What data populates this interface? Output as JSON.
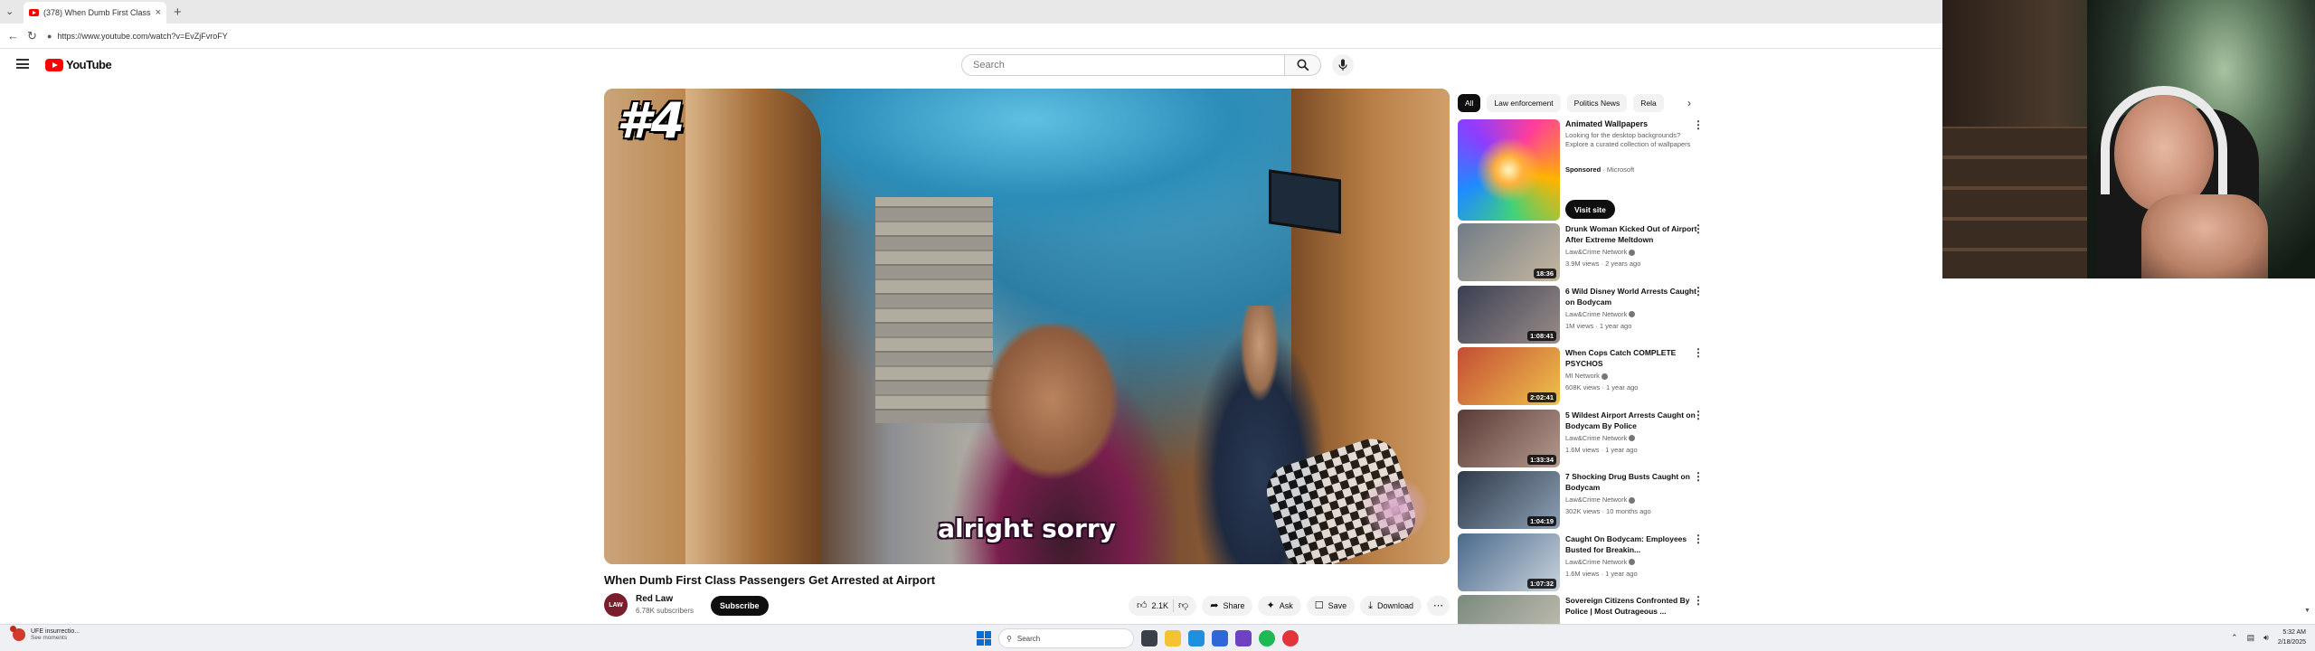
{
  "browser": {
    "tab_title": "(378) When Dumb First Class",
    "url": "https://www.youtube.com/watch?v=EvZjFvroFY"
  },
  "youtube": {
    "logo_text": "YouTube",
    "search_placeholder": "Search"
  },
  "player": {
    "overlay_rank": "#4",
    "caption": "alright sorry"
  },
  "video": {
    "title": "When Dumb First Class Passengers Get Arrested at Airport",
    "channel_name": "Red Law",
    "channel_avatar_text": "LAW",
    "subscribers": "6.78K subscribers",
    "subscribe_label": "Subscribe",
    "like_count": "2.1K",
    "share_label": "Share",
    "ask_label": "Ask",
    "save_label": "Save",
    "download_label": "Download"
  },
  "chips": [
    "All",
    "Law enforcement",
    "Politics News",
    "Rela"
  ],
  "ad": {
    "title": "Animated Wallpapers",
    "description": "Looking for the desktop backgrounds? Explore a curated collection of wallpapers",
    "sponsored_label": "Sponsored",
    "sponsor": "Microsoft",
    "button_label": "Visit site"
  },
  "recommendations": [
    {
      "title": "Drunk Woman Kicked Out of Airport After Extreme Meltdown",
      "channel": "Law&Crime Network",
      "meta": "3.9M views · 2 years ago",
      "duration": "18:36",
      "colors": [
        "#6f7c86",
        "#c7b7a0"
      ]
    },
    {
      "title": "6 Wild Disney World Arrests Caught on Bodycam",
      "channel": "Law&Crime Network",
      "meta": "1M views · 1 year ago",
      "duration": "1:08:41",
      "colors": [
        "#3a3f52",
        "#9a8c88"
      ]
    },
    {
      "title": "When Cops Catch COMPLETE PSYCHOS",
      "channel": "MI Network",
      "meta": "608K views · 1 year ago",
      "duration": "2:02:41",
      "colors": [
        "#c24d35",
        "#f0c24a"
      ]
    },
    {
      "title": "5 Wildest Airport Arrests Caught on Bodycam By Police",
      "channel": "Law&Crime Network",
      "meta": "1.6M views · 1 year ago",
      "duration": "1:33:34",
      "colors": [
        "#5a3a36",
        "#b49a8e"
      ]
    },
    {
      "title": "7 Shocking Drug Busts Caught on Bodycam",
      "channel": "Law&Crime Network",
      "meta": "302K views · 10 months ago",
      "duration": "1:04:19",
      "colors": [
        "#2e3a4a",
        "#8da0b4"
      ]
    },
    {
      "title": "Caught On Bodycam: Employees Busted for Breakin...",
      "channel": "Law&Crime Network",
      "meta": "1.6M views · 1 year ago",
      "duration": "1:07:32",
      "colors": [
        "#4a6a8c",
        "#c9d3dc"
      ]
    },
    {
      "title": "Sovereign Citizens Confronted By Police | Most Outrageous ...",
      "channel": "",
      "meta": "",
      "duration": "",
      "colors": [
        "#7a8a7e",
        "#c8c2b6"
      ]
    }
  ],
  "taskbar": {
    "weather_line1": "UFE insurrectio...",
    "weather_line2": "See moments",
    "search_label": "Search",
    "time": "5:32 AM",
    "date": "2/18/2025"
  }
}
